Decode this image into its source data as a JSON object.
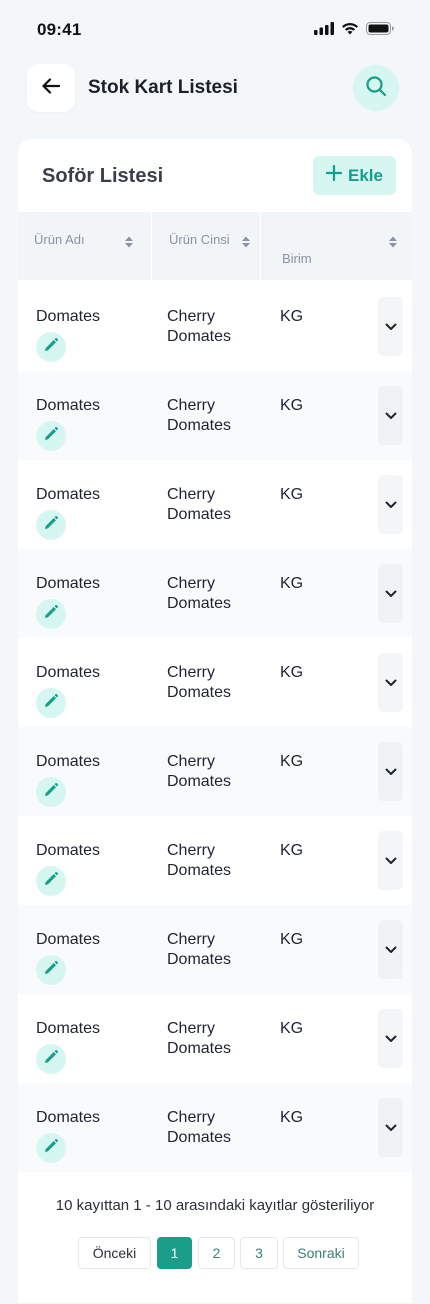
{
  "status_bar": {
    "time": "09:41"
  },
  "header": {
    "title": "Stok Kart Listesi",
    "back_icon": "arrow-left-icon",
    "search_icon": "search-icon"
  },
  "card": {
    "title": "Soför Listesi",
    "add_label": "Ekle"
  },
  "table": {
    "columns": [
      {
        "label": "Ürün Adı"
      },
      {
        "label": "Ürün Cinsi"
      },
      {
        "label": "Birim"
      }
    ],
    "rows": [
      {
        "name": "Domates",
        "type": "Cherry Domates",
        "unit": "KG"
      },
      {
        "name": "Domates",
        "type": "Cherry Domates",
        "unit": "KG"
      },
      {
        "name": "Domates",
        "type": "Cherry Domates",
        "unit": "KG"
      },
      {
        "name": "Domates",
        "type": "Cherry Domates",
        "unit": "KG"
      },
      {
        "name": "Domates",
        "type": "Cherry Domates",
        "unit": "KG"
      },
      {
        "name": "Domates",
        "type": "Cherry Domates",
        "unit": "KG"
      },
      {
        "name": "Domates",
        "type": "Cherry Domates",
        "unit": "KG"
      },
      {
        "name": "Domates",
        "type": "Cherry Domates",
        "unit": "KG"
      },
      {
        "name": "Domates",
        "type": "Cherry Domates",
        "unit": "KG"
      },
      {
        "name": "Domates",
        "type": "Cherry Domates",
        "unit": "KG"
      }
    ]
  },
  "pagination": {
    "info": "10 kayıttan 1 - 10 arasındaki kayıtlar gösteriliyor",
    "prev": "Önceki",
    "pages": [
      "1",
      "2",
      "3"
    ],
    "next": "Sonraki"
  },
  "colors": {
    "accent": "#1a9e89",
    "accent_light": "#d6f6f1"
  }
}
